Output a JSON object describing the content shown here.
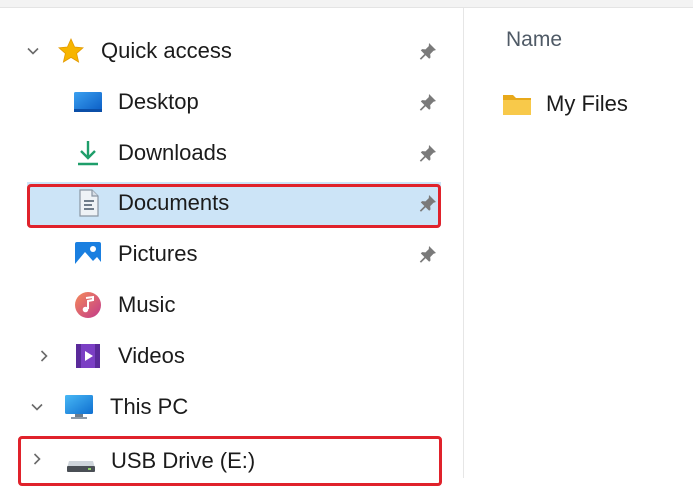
{
  "nav": {
    "items": [
      {
        "label": "Quick access",
        "icon": "star-icon",
        "expanded": true,
        "pinned": true
      },
      {
        "label": "Desktop",
        "icon": "desktop-icon",
        "pinned": true
      },
      {
        "label": "Downloads",
        "icon": "download-icon",
        "pinned": true
      },
      {
        "label": "Documents",
        "icon": "documents-icon",
        "pinned": true,
        "selected": true,
        "highlighted": true
      },
      {
        "label": "Pictures",
        "icon": "pictures-icon",
        "pinned": true
      },
      {
        "label": "Music",
        "icon": "music-icon",
        "pinned": true
      },
      {
        "label": "Videos",
        "icon": "videos-icon",
        "expanded": false
      },
      {
        "label": "This PC",
        "icon": "computer-icon",
        "expanded": true
      },
      {
        "label": "USB Drive (E:)",
        "icon": "usb-drive-icon",
        "expanded": false,
        "highlighted": true
      }
    ]
  },
  "content": {
    "column_header": "Name",
    "files": [
      {
        "name": "My Files",
        "icon": "folder-icon"
      }
    ]
  },
  "colors": {
    "selection": "#cce4f7",
    "highlight_border": "#e0222b",
    "folder": "#f5c242",
    "star": "#f7b500"
  }
}
